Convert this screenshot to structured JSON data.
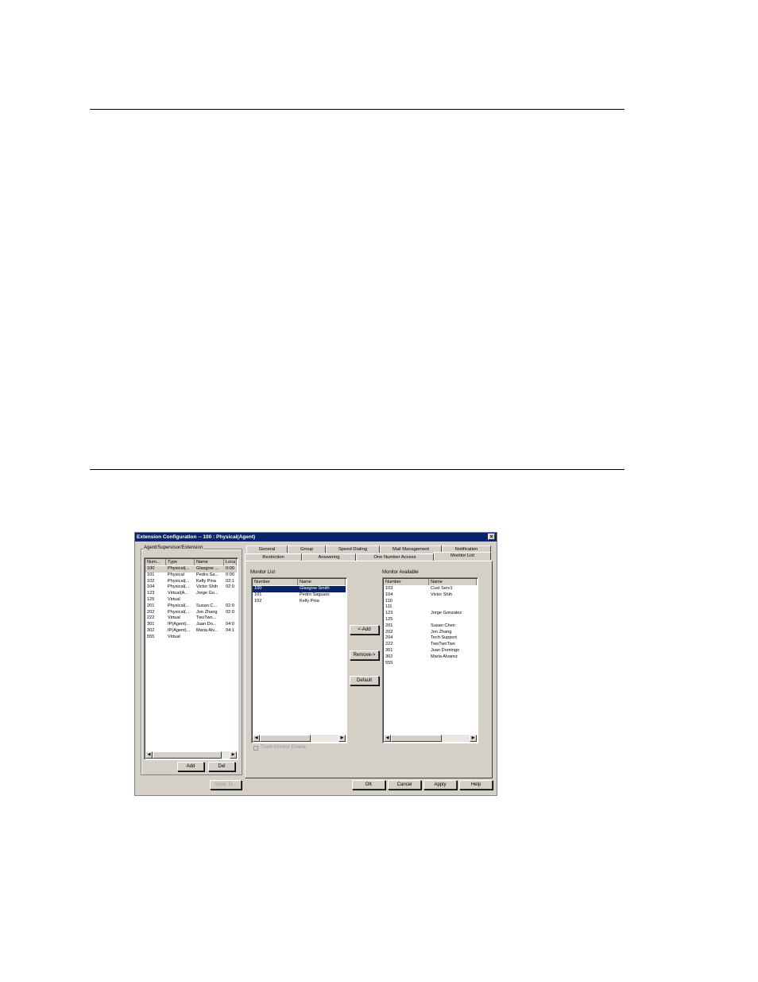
{
  "window": {
    "title": "Extension Configuration -- 100 : Physical(Agent)",
    "close_glyph": "×"
  },
  "left_panel": {
    "group_label": "Agent/Supervisor/Extension",
    "columns": [
      "Num...",
      "Type",
      "Name",
      "Loca"
    ],
    "rows": [
      [
        "100",
        "Physical(...",
        "Glasgow ...",
        "0:00"
      ],
      [
        "101",
        "Physical",
        "Pedro Sa...",
        "0:00"
      ],
      [
        "102",
        "Physical(...",
        "Kelly Pina",
        "02:1"
      ],
      [
        "104",
        "Physical(...",
        "Victor Shih",
        "02:0"
      ],
      [
        "123",
        "Virtual(A...",
        "Jorge Go...",
        ""
      ],
      [
        "125",
        "Virtual",
        "",
        ""
      ],
      [
        "201",
        "Physical(...",
        "Susan C...",
        "02:0"
      ],
      [
        "202",
        "Physical(...",
        "Jon Zhang",
        "02:0"
      ],
      [
        "222",
        "Virtual",
        "TwoTwo...",
        ""
      ],
      [
        "301",
        "IP(Agent)...",
        "Juan Do...",
        "04:0"
      ],
      [
        "302",
        "IP(Agent)...",
        "Maria Alv...",
        "04:1"
      ],
      [
        "555",
        "Virtual",
        "",
        ""
      ]
    ],
    "add_label": "Add",
    "del_label": "Del"
  },
  "tabs": {
    "row_back": [
      "General",
      "Group",
      "Speed Dialing",
      "Mail Management",
      "Notification"
    ],
    "row_front": [
      "Restriction",
      "Answering",
      "One Number Access",
      "Monitor List"
    ],
    "active": "Monitor List"
  },
  "monitor_list": {
    "label": "Monitor List",
    "columns": [
      "Number",
      "Name"
    ],
    "rows": [
      [
        "100",
        "Glasgow Smith"
      ],
      [
        "101",
        "Pedro Saguaro"
      ],
      [
        "102",
        "Kelly Pina"
      ]
    ]
  },
  "monitor_available": {
    "label": "Monitor Available",
    "columns": [
      "Number",
      "Name"
    ],
    "rows": [
      [
        "103",
        "Cust Serv1"
      ],
      [
        "104",
        "Victor Shih"
      ],
      [
        "110",
        ""
      ],
      [
        "111",
        ""
      ],
      [
        "123",
        "Jorge Gonzalez"
      ],
      [
        "125",
        ""
      ],
      [
        "201",
        "Susan Chen"
      ],
      [
        "202",
        "Jon Zhang"
      ],
      [
        "204",
        "Tech Support"
      ],
      [
        "222",
        "TwoTwoTwo"
      ],
      [
        "301",
        "Juan Domingo"
      ],
      [
        "302",
        "Maria Alvarez"
      ],
      [
        "555",
        ""
      ]
    ]
  },
  "middle_buttons": {
    "add": "<-Add",
    "remove": "Remove->",
    "default": "Default"
  },
  "trunk_monitor": {
    "label": "Trunk Monitor Enable",
    "checked": false
  },
  "bottom_buttons": {
    "apply_to": "Apply To...",
    "ok": "OK",
    "cancel": "Cancel",
    "apply": "Apply",
    "help": "Help"
  },
  "colors": {
    "titlebar": "#0a246a",
    "face": "#d4d0c8",
    "selection": "#0a246a"
  }
}
